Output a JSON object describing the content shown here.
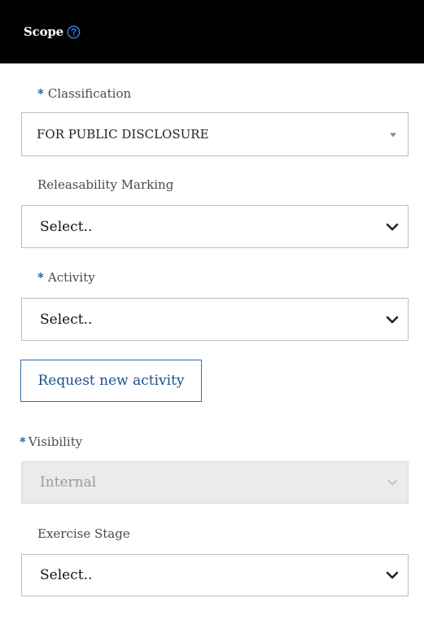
{
  "header": {
    "title": "Scope",
    "help_icon": "question-circle-icon"
  },
  "colors": {
    "header_bg": "#000000",
    "accent": "#1a4f8b",
    "help_icon": "#2f7de1",
    "disabled_bg": "#e9ebed"
  },
  "required_marker": "*",
  "classification": {
    "label": "Classification",
    "required": true,
    "value": "FOR PUBLIC DISCLOSURE"
  },
  "releasability": {
    "label": "Releasability Marking",
    "required": false,
    "value": "Select.."
  },
  "activity": {
    "label": "Activity",
    "required": true,
    "value": "Select.."
  },
  "request_button": {
    "label": "Request new activity"
  },
  "visibility": {
    "label": "Visibility",
    "required": true,
    "value": "Internal",
    "disabled": true
  },
  "exercise_stage": {
    "label": "Exercise Stage",
    "required": false,
    "value": "Select.."
  }
}
